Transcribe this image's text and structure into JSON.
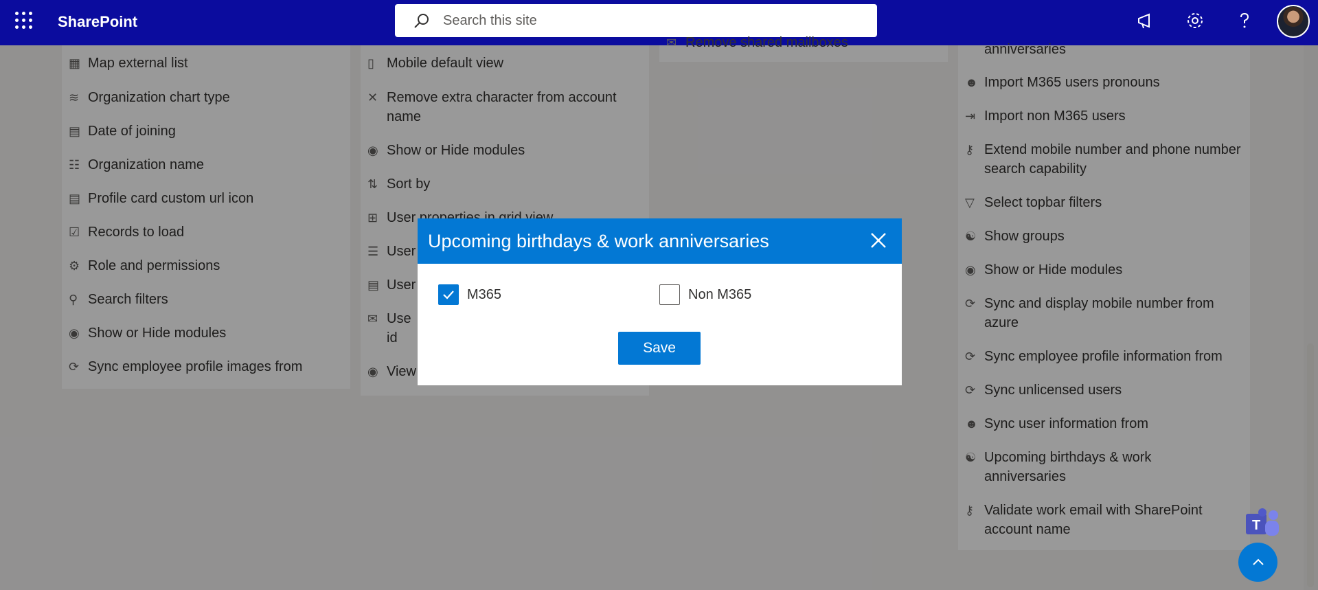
{
  "topbar": {
    "brand": "SharePoint",
    "search_placeholder": "Search this site"
  },
  "col1": {
    "items": [
      {
        "label": "Map external list",
        "icon": "map-list-icon"
      },
      {
        "label": "Organization chart type",
        "icon": "chart-icon"
      },
      {
        "label": "Date of joining",
        "icon": "calendar-icon"
      },
      {
        "label": "Organization name",
        "icon": "org-icon"
      },
      {
        "label": "Profile card custom url icon",
        "icon": "contact-card-icon"
      },
      {
        "label": "Records to load",
        "icon": "checklist-icon"
      },
      {
        "label": "Role and permissions",
        "icon": "badge-icon"
      },
      {
        "label": "Search filters",
        "icon": "search-icon"
      },
      {
        "label": "Show or Hide modules",
        "icon": "eye-icon"
      },
      {
        "label": "Sync employee profile images from",
        "icon": "sync-icon"
      }
    ]
  },
  "col2": {
    "items": [
      {
        "label": "Mobile default view",
        "icon": "mobile-icon"
      },
      {
        "label": "Remove extra character from account name",
        "icon": "close-icon"
      },
      {
        "label": "Show or Hide modules",
        "icon": "eye-icon"
      },
      {
        "label": "Sort by",
        "icon": "sort-icon"
      },
      {
        "label": "User properties in grid view",
        "icon": "grid-icon"
      },
      {
        "label": "User",
        "icon": "list-icon"
      },
      {
        "label": "User",
        "icon": "contact-card-icon"
      },
      {
        "label": "Use id",
        "icon": "mail-icon"
      },
      {
        "label": "View",
        "icon": "eye-icon"
      }
    ]
  },
  "col3": {
    "items": [
      {
        "label": "Remove shared mailboxes",
        "icon": "mailbox-icon"
      }
    ]
  },
  "col4": {
    "items": [
      {
        "label": "anniversaries",
        "icon": ""
      },
      {
        "label": "Import M365 users pronouns",
        "icon": "person-tag-icon"
      },
      {
        "label": "Import non M365 users",
        "icon": "import-icon"
      },
      {
        "label": "Extend mobile number and phone number search capability",
        "icon": "key-icon"
      },
      {
        "label": "Select topbar filters",
        "icon": "filter-icon"
      },
      {
        "label": "Show groups",
        "icon": "people-icon"
      },
      {
        "label": "Show or Hide modules",
        "icon": "eye-icon"
      },
      {
        "label": "Sync and display mobile number from azure",
        "icon": "sync-icon"
      },
      {
        "label": "Sync employee profile information from",
        "icon": "sync-icon"
      },
      {
        "label": "Sync unlicensed users",
        "icon": "sync-icon"
      },
      {
        "label": "Sync user information from",
        "icon": "person-sync-icon"
      },
      {
        "label": "Upcoming birthdays & work anniversaries",
        "icon": "people-icon"
      },
      {
        "label": "Validate work email with SharePoint account name",
        "icon": "key-icon"
      }
    ]
  },
  "dialog": {
    "title": "Upcoming birthdays & work anniversaries",
    "options": [
      {
        "label": "M365",
        "checked": true
      },
      {
        "label": "Non M365",
        "checked": false
      }
    ],
    "save_label": "Save"
  },
  "colors": {
    "topbar": "#0b0c9e",
    "accent": "#0378d4"
  }
}
